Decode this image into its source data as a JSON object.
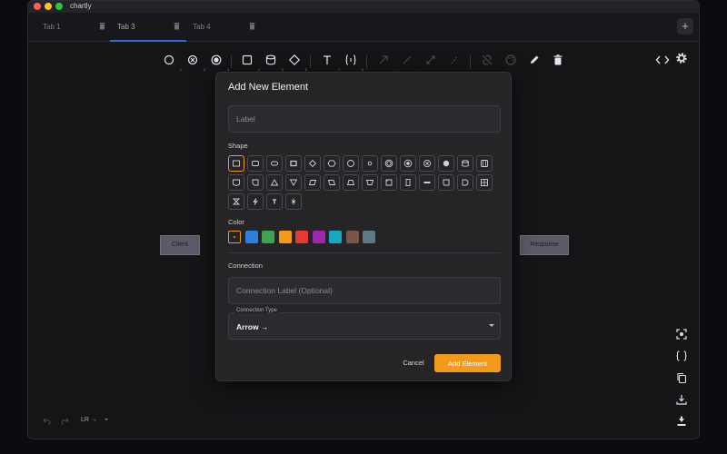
{
  "window": {
    "title": "chartly"
  },
  "tabs": [
    {
      "label": "Tab 1",
      "active": false
    },
    {
      "label": "Tab 3",
      "active": true
    },
    {
      "label": "Tab 4",
      "active": false
    }
  ],
  "tab_add_label": "+",
  "toolbar": {
    "tools": [
      {
        "name": "circle-tool-icon",
        "sub": "1"
      },
      {
        "name": "cross-circle-tool-icon",
        "sub": "2"
      },
      {
        "name": "double-circle-tool-icon",
        "sub": "3"
      },
      {
        "name": "rectangle-tool-icon",
        "sub": "4"
      },
      {
        "name": "cylinder-tool-icon",
        "sub": "5"
      },
      {
        "name": "diamond-tool-icon",
        "sub": "6"
      },
      {
        "name": "text-tool-icon",
        "sub": "7"
      },
      {
        "name": "braces-tool-icon",
        "sub": "8"
      },
      {
        "name": "arrow-tool-icon",
        "sub": "9"
      },
      {
        "name": "line-tool-icon",
        "sub": "0"
      },
      {
        "name": "expand-tool-icon",
        "sub": ""
      },
      {
        "name": "slash-tool-icon",
        "sub": ""
      },
      {
        "name": "unlink-tool-icon",
        "sub": ""
      },
      {
        "name": "palette-tool-icon",
        "sub": ""
      },
      {
        "name": "pencil-tool-icon",
        "sub": ""
      },
      {
        "name": "trash-tool-icon",
        "sub": ""
      }
    ]
  },
  "canvas": {
    "nodes": [
      {
        "label": "Client"
      },
      {
        "label": "Response"
      }
    ],
    "direction_label": "LR →"
  },
  "dialog": {
    "title": "Add New Element",
    "label_placeholder": "Label",
    "shape_label": "Shape",
    "color_label": "Color",
    "connection_label": "Connection",
    "connection_placeholder": "Connection Label (Optional)",
    "connection_type_legend": "Connection Type",
    "connection_type_value": "Arrow →",
    "cancel_label": "Cancel",
    "add_label": "Add Element",
    "colors": [
      "#f39a1a",
      "#2f7fe0",
      "#3fa34d",
      "#f39a1a",
      "#e53935",
      "#9c27b0",
      "#17a9c4",
      "#795548",
      "#5e7a86"
    ],
    "selected_color_index": 0
  },
  "accent_color": "#f39a1a"
}
